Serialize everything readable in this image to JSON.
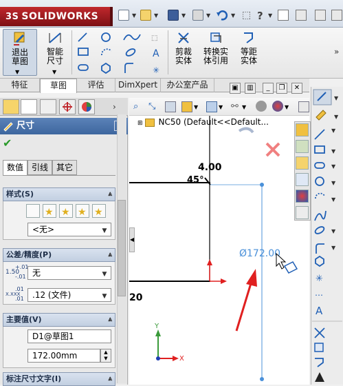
{
  "app": {
    "name": "SOLIDWORKS",
    "logo_prefix": "3S"
  },
  "ribbon": {
    "exit_sketch": "退出草图",
    "smart_dimension": "智能尺寸",
    "trim_entities": "剪裁实体",
    "convert_entities": "转换实体引用",
    "offset_entities": "等距实体"
  },
  "tabs": [
    "特征",
    "草图",
    "评估",
    "DimXpert",
    "办公室产品"
  ],
  "active_tab": "草图",
  "property_manager": {
    "title": "尺寸",
    "subtabs": [
      "数值",
      "引线",
      "其它"
    ],
    "style_group": {
      "title": "样式(S)",
      "selected": "<无>"
    },
    "tolerance_group": {
      "title": "公差/精度(P)",
      "tolerance_type": "无",
      "tol_icon_top": "1.50",
      "tol_sup": "+.01",
      "tol_sub": "-.01",
      "precision": ".12 (文件)",
      "prec_icon": "X.XXX",
      "prec_sup": ".01",
      "prec_sub": ".01"
    },
    "primary_value_group": {
      "title": "主要值(V)",
      "name": "D1@草图1",
      "value": "172.00mm"
    },
    "dim_text_group": {
      "title": "标注尺寸文字(I)"
    }
  },
  "graphics": {
    "tree_root": "NC50",
    "tree_config": "(Default<<Default...",
    "dim_horizontal": "4.00",
    "dim_angle": "45°",
    "dim_diameter": "Ø172.00",
    "dim_left": "20",
    "axis_x": "X",
    "axis_y": "Y"
  },
  "colors": {
    "accent_blue": "#4a90d9",
    "arrow_red": "#e02020",
    "header_blue": "#3d669e",
    "ok_green": "#2a9a2a"
  }
}
